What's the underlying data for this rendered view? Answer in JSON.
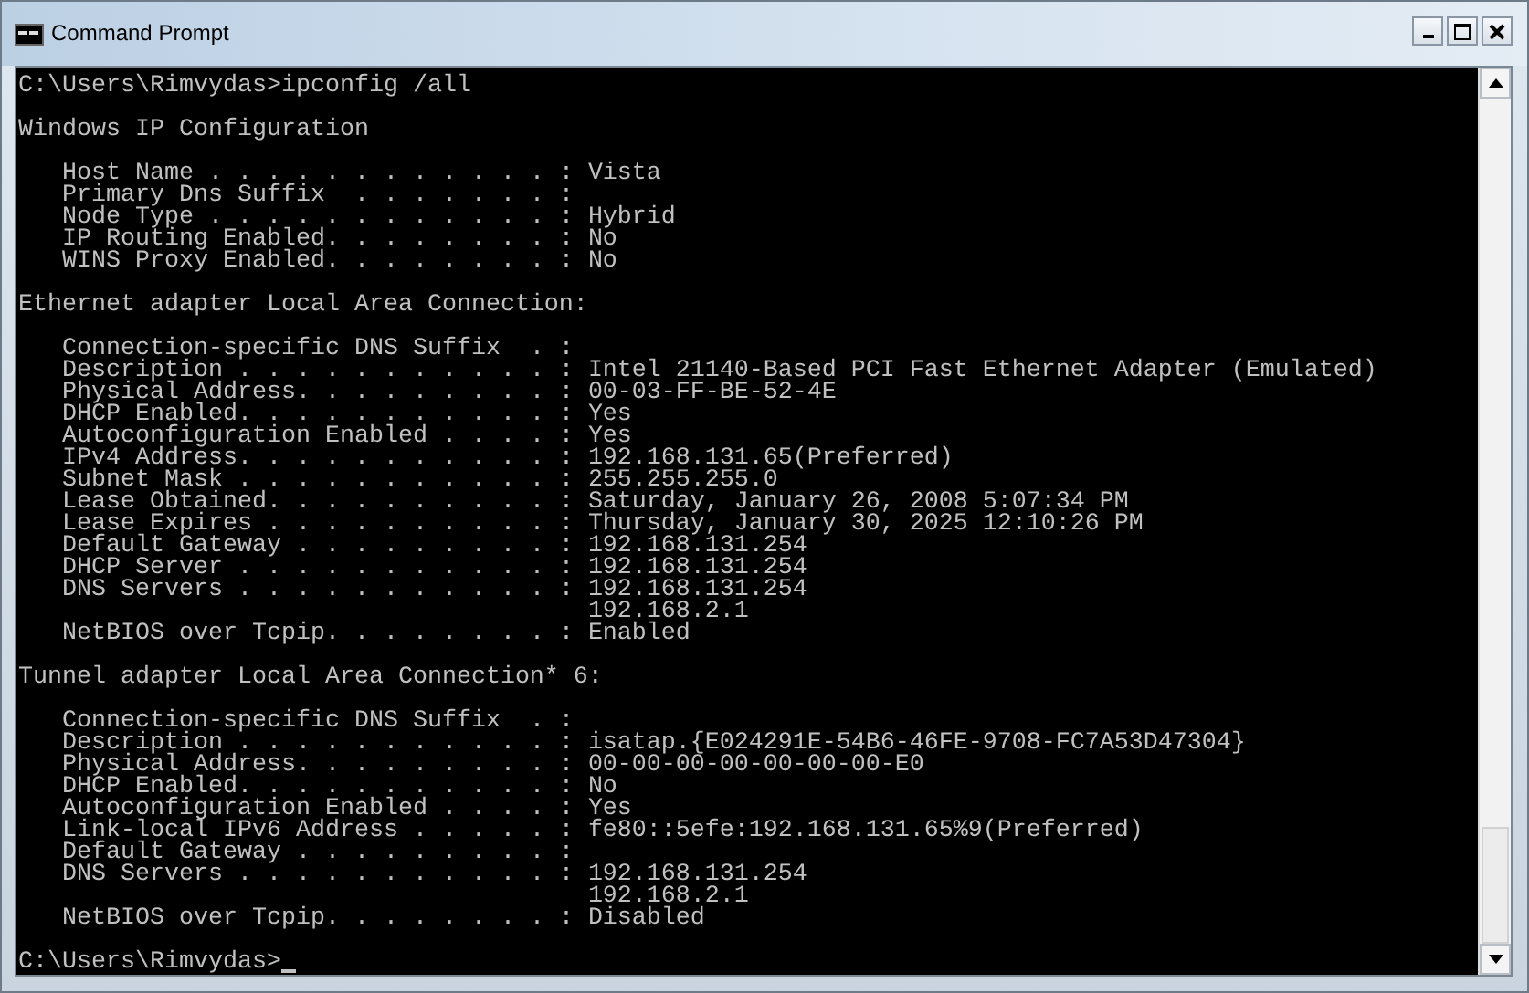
{
  "window": {
    "title": "Command Prompt"
  },
  "console": {
    "blocks": [
      {
        "kind": "text",
        "lines": [
          "C:\\Users\\Rimvydas>ipconfig /all"
        ]
      },
      {
        "kind": "text",
        "lines": [
          "Windows IP Configuration"
        ]
      },
      {
        "kind": "props",
        "rows": [
          {
            "label": "Host Name . . . . . . . . . . . . :",
            "values": [
              "Vista"
            ]
          },
          {
            "label": "Primary Dns Suffix  . . . . . . . :",
            "values": []
          },
          {
            "label": "Node Type . . . . . . . . . . . . :",
            "values": [
              "Hybrid"
            ]
          },
          {
            "label": "IP Routing Enabled. . . . . . . . :",
            "values": [
              "No"
            ]
          },
          {
            "label": "WINS Proxy Enabled. . . . . . . . :",
            "values": [
              "No"
            ]
          }
        ]
      },
      {
        "kind": "text",
        "lines": [
          "Ethernet adapter Local Area Connection:"
        ]
      },
      {
        "kind": "props",
        "rows": [
          {
            "label": "Connection-specific DNS Suffix  . :",
            "values": []
          },
          {
            "label": "Description . . . . . . . . . . . :",
            "values": [
              "Intel 21140-Based PCI Fast Ethernet Adapter (Emulated)"
            ]
          },
          {
            "label": "Physical Address. . . . . . . . . :",
            "values": [
              "00-03-FF-BE-52-4E"
            ]
          },
          {
            "label": "DHCP Enabled. . . . . . . . . . . :",
            "values": [
              "Yes"
            ]
          },
          {
            "label": "Autoconfiguration Enabled . . . . :",
            "values": [
              "Yes"
            ]
          },
          {
            "label": "IPv4 Address. . . . . . . . . . . :",
            "values": [
              "192.168.131.65(Preferred)"
            ]
          },
          {
            "label": "Subnet Mask . . . . . . . . . . . :",
            "values": [
              "255.255.255.0"
            ]
          },
          {
            "label": "Lease Obtained. . . . . . . . . . :",
            "values": [
              "Saturday, January 26, 2008 5:07:34 PM"
            ]
          },
          {
            "label": "Lease Expires . . . . . . . . . . :",
            "values": [
              "Thursday, January 30, 2025 12:10:26 PM"
            ]
          },
          {
            "label": "Default Gateway . . . . . . . . . :",
            "values": [
              "192.168.131.254"
            ]
          },
          {
            "label": "DHCP Server . . . . . . . . . . . :",
            "values": [
              "192.168.131.254"
            ]
          },
          {
            "label": "DNS Servers . . . . . . . . . . . :",
            "values": [
              "192.168.131.254",
              "192.168.2.1"
            ]
          },
          {
            "label": "NetBIOS over Tcpip. . . . . . . . :",
            "values": [
              "Enabled"
            ]
          }
        ]
      },
      {
        "kind": "text",
        "lines": [
          "Tunnel adapter Local Area Connection* 6:"
        ]
      },
      {
        "kind": "props",
        "rows": [
          {
            "label": "Connection-specific DNS Suffix  . :",
            "values": []
          },
          {
            "label": "Description . . . . . . . . . . . :",
            "values": [
              "isatap.{E024291E-54B6-46FE-9708-FC7A53D47304}"
            ]
          },
          {
            "label": "Physical Address. . . . . . . . . :",
            "values": [
              "00-00-00-00-00-00-00-E0"
            ]
          },
          {
            "label": "DHCP Enabled. . . . . . . . . . . :",
            "values": [
              "No"
            ]
          },
          {
            "label": "Autoconfiguration Enabled . . . . :",
            "values": [
              "Yes"
            ]
          },
          {
            "label": "Link-local IPv6 Address . . . . . :",
            "values": [
              "fe80::5efe:192.168.131.65%9(Preferred)"
            ]
          },
          {
            "label": "Default Gateway . . . . . . . . . :",
            "values": []
          },
          {
            "label": "DNS Servers . . . . . . . . . . . :",
            "values": [
              "192.168.131.254",
              "192.168.2.1"
            ]
          },
          {
            "label": "NetBIOS over Tcpip. . . . . . . . :",
            "values": [
              "Disabled"
            ]
          }
        ]
      }
    ],
    "prompt": {
      "text": "C:\\Users\\Rimvydas>",
      "cursor": true
    }
  }
}
